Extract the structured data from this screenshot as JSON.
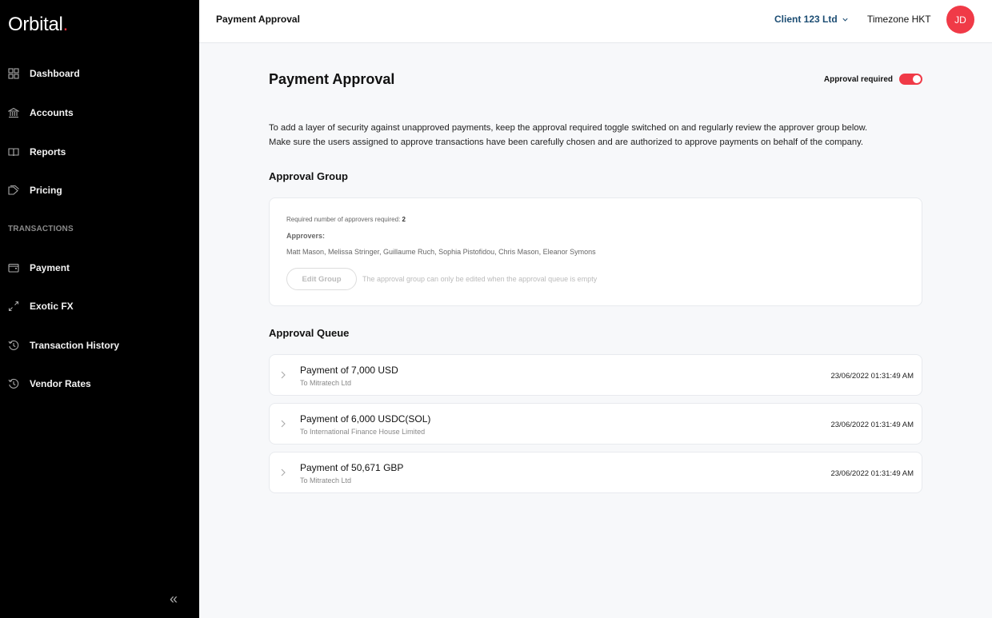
{
  "sidebar": {
    "logo": {
      "text": "Orbital",
      "dot": "."
    },
    "items": [
      {
        "label": "Dashboard",
        "icon": "dashboard-grid-icon"
      },
      {
        "label": "Accounts",
        "icon": "bank-icon"
      },
      {
        "label": "Reports",
        "icon": "book-icon"
      },
      {
        "label": "Pricing",
        "icon": "tag-icon"
      }
    ],
    "section_label": "TRANSACTIONS",
    "transaction_items": [
      {
        "label": "Payment",
        "icon": "wallet-icon"
      },
      {
        "label": "Exotic FX",
        "icon": "exchange-arrows-icon"
      },
      {
        "label": "Transaction History",
        "icon": "history-icon"
      },
      {
        "label": "Vendor Rates",
        "icon": "history-icon"
      }
    ],
    "collapse_glyph": "«"
  },
  "topbar": {
    "title": "Payment Approval",
    "client": "Client 123 Ltd",
    "timezone": "Timezone HKT",
    "avatar_initials": "JD"
  },
  "colors": {
    "accent_red": "#f03a47",
    "client_blue": "#1c4d73"
  },
  "main": {
    "title": "Payment Approval",
    "approval_required_label": "Approval required",
    "approval_required_on": true,
    "intro_line1": "To add a layer of security against unapproved payments, keep the approval required toggle switched on and regularly review the approver group below.",
    "intro_line2": "Make sure the users assigned to approve transactions have been carefully chosen and are authorized to approve payments on behalf of the company.",
    "group": {
      "heading": "Approval Group",
      "required_label": "Required number of approvers required: ",
      "required_count": "2",
      "approvers_label": "Approvers:",
      "approvers": "Matt Mason, Melissa Stringer, Guillaume Ruch, Sophia Pistofidou, Chris Mason, Eleanor Symons",
      "edit_button": "Edit Group",
      "edit_hint": "The approval group can only be edited when the approval queue is empty"
    },
    "queue": {
      "heading": "Approval Queue",
      "items": [
        {
          "title": "Payment of 7,000 USD",
          "recipient": "To Mitratech Ltd",
          "timestamp": "23/06/2022 01:31:49 AM"
        },
        {
          "title": "Payment of 6,000 USDC(SOL)",
          "recipient": "To International Finance House Limited",
          "timestamp": "23/06/2022 01:31:49 AM"
        },
        {
          "title": "Payment of 50,671 GBP",
          "recipient": "To Mitratech Ltd",
          "timestamp": "23/06/2022 01:31:49 AM"
        }
      ]
    }
  }
}
